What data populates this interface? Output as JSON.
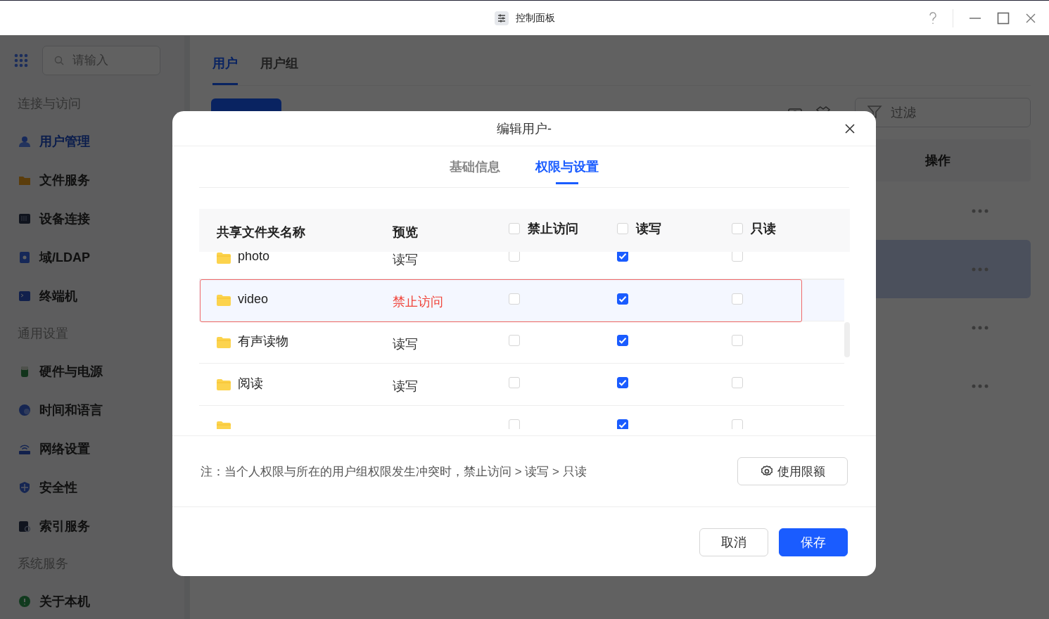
{
  "window": {
    "title": "控制面板"
  },
  "sidebar": {
    "search": {
      "placeholder": "请输入"
    },
    "sections": [
      {
        "title": "连接与访问",
        "items": [
          {
            "label": "用户管理",
            "selected": true
          },
          {
            "label": "文件服务",
            "selected": false
          },
          {
            "label": "设备连接",
            "selected": false
          },
          {
            "label": "域/LDAP",
            "selected": false
          },
          {
            "label": "终端机",
            "selected": false
          }
        ]
      },
      {
        "title": "通用设置",
        "items": [
          {
            "label": "硬件与电源",
            "selected": false
          },
          {
            "label": "时间和语言",
            "selected": false
          },
          {
            "label": "网络设置",
            "selected": false
          },
          {
            "label": "安全性",
            "selected": false
          },
          {
            "label": "索引服务",
            "selected": false
          }
        ]
      },
      {
        "title": "系统服务",
        "items": [
          {
            "label": "关于本机",
            "selected": false
          }
        ]
      }
    ]
  },
  "main": {
    "tabs": [
      {
        "label": "用户",
        "selected": true
      },
      {
        "label": "用户组",
        "selected": false
      }
    ],
    "filter": {
      "placeholder": "过滤"
    },
    "table": {
      "columns": [
        "操作"
      ],
      "rows": [
        {
          "selected": false
        },
        {
          "selected": true
        },
        {
          "selected": false
        },
        {
          "selected": false
        }
      ]
    }
  },
  "dialog": {
    "title": "编辑用户-",
    "tabs": [
      {
        "label": "基础信息",
        "selected": false
      },
      {
        "label": "权限与设置",
        "selected": true
      }
    ],
    "table": {
      "columns": [
        {
          "label": "共享文件夹名称",
          "kind": "text"
        },
        {
          "label": "预览",
          "kind": "text"
        },
        {
          "label": "禁止访问",
          "kind": "check",
          "checked": false
        },
        {
          "label": "读写",
          "kind": "check",
          "checked": false
        },
        {
          "label": "只读",
          "kind": "check",
          "checked": false
        }
      ],
      "rows": [
        {
          "name": "photo",
          "preview": "读写",
          "warning": false,
          "deny": false,
          "read_write": true,
          "read_only": false,
          "selected": false
        },
        {
          "name": "video",
          "preview": "禁止访问",
          "warning": true,
          "deny": false,
          "read_write": true,
          "read_only": false,
          "selected": true
        },
        {
          "name": "有声读物",
          "preview": "读写",
          "warning": false,
          "deny": false,
          "read_write": true,
          "read_only": false,
          "selected": false
        },
        {
          "name": "阅读",
          "preview": "读写",
          "warning": false,
          "deny": false,
          "read_write": true,
          "read_only": false,
          "selected": false
        },
        {
          "deny": false,
          "read_write": true,
          "read_only": false,
          "selected": false
        }
      ]
    },
    "note": "注：当个人权限与所在的用户组权限发生冲突时，禁止访问 > 读写 > 只读",
    "quota_button": "使用限额",
    "buttons": [
      {
        "label": "取消",
        "kind": "secondary"
      },
      {
        "label": "保存",
        "kind": "primary"
      }
    ]
  }
}
